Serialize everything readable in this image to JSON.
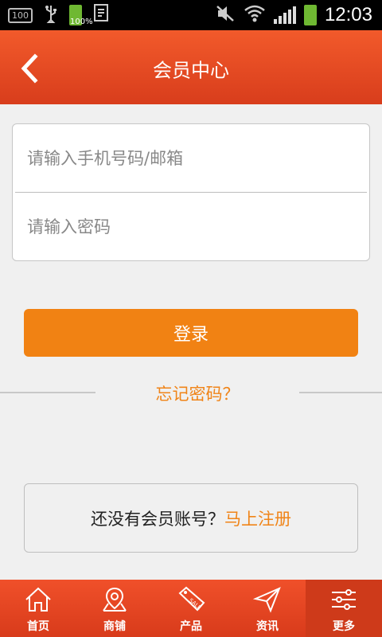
{
  "status_bar": {
    "left_badge": "100",
    "battery_small_label": "100%",
    "time": "12:03"
  },
  "header": {
    "title": "会员中心"
  },
  "form": {
    "phone_placeholder": "请输入手机号码/邮箱",
    "password_placeholder": "请输入密码"
  },
  "login_label": "登录",
  "forgot_label": "忘记密码？",
  "register": {
    "prompt": "还没有会员账号？",
    "link": "马上注册"
  },
  "bottom_nav": {
    "items": [
      {
        "label": "首页",
        "icon": "home-icon"
      },
      {
        "label": "商铺",
        "icon": "map-pin-icon"
      },
      {
        "label": "产品",
        "icon": "sale-tag-icon"
      },
      {
        "label": "资讯",
        "icon": "send-icon"
      },
      {
        "label": "更多",
        "icon": "sliders-icon"
      }
    ],
    "active_index": 4
  },
  "colors": {
    "header": "#e24a23",
    "accent": "#f18213",
    "background": "#f0f0f0"
  }
}
